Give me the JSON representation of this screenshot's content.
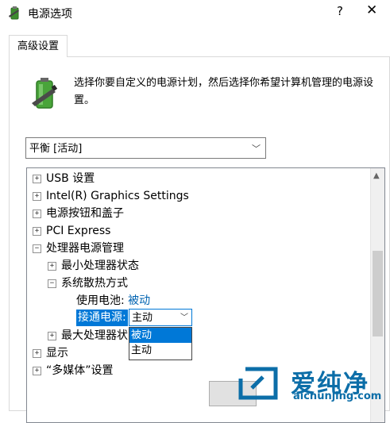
{
  "window": {
    "title": "电源选项",
    "help": "?",
    "close": "✕"
  },
  "tab": "高级设置",
  "description": "选择你要自定义的电源计划，然后选择你希望计算机管理的电源设置。",
  "plan_select": {
    "value": "平衡 [活动]"
  },
  "tree": {
    "usb": "USB 设置",
    "graphics": "Intel(R) Graphics Settings",
    "buttons": "电源按钮和盖子",
    "pci": "PCI Express",
    "processor": "处理器电源管理",
    "min_state": "最小处理器状态",
    "cooling": "系统散热方式",
    "on_battery_label": "使用电池:",
    "on_battery_value": "被动",
    "plugged_in_label": "接通电源:",
    "plugged_in_value": "主动",
    "max_state": "最大处理器状",
    "display": "显示",
    "multimedia": "“多媒体”设置"
  },
  "dropdown_options": [
    "被动",
    "主动"
  ],
  "watermark": {
    "text": "爱纯净",
    "url": "aichunjing.com"
  },
  "colors": {
    "accent": "#0078d7",
    "link": "#0063b1",
    "watermark": "#0c6ea8"
  }
}
